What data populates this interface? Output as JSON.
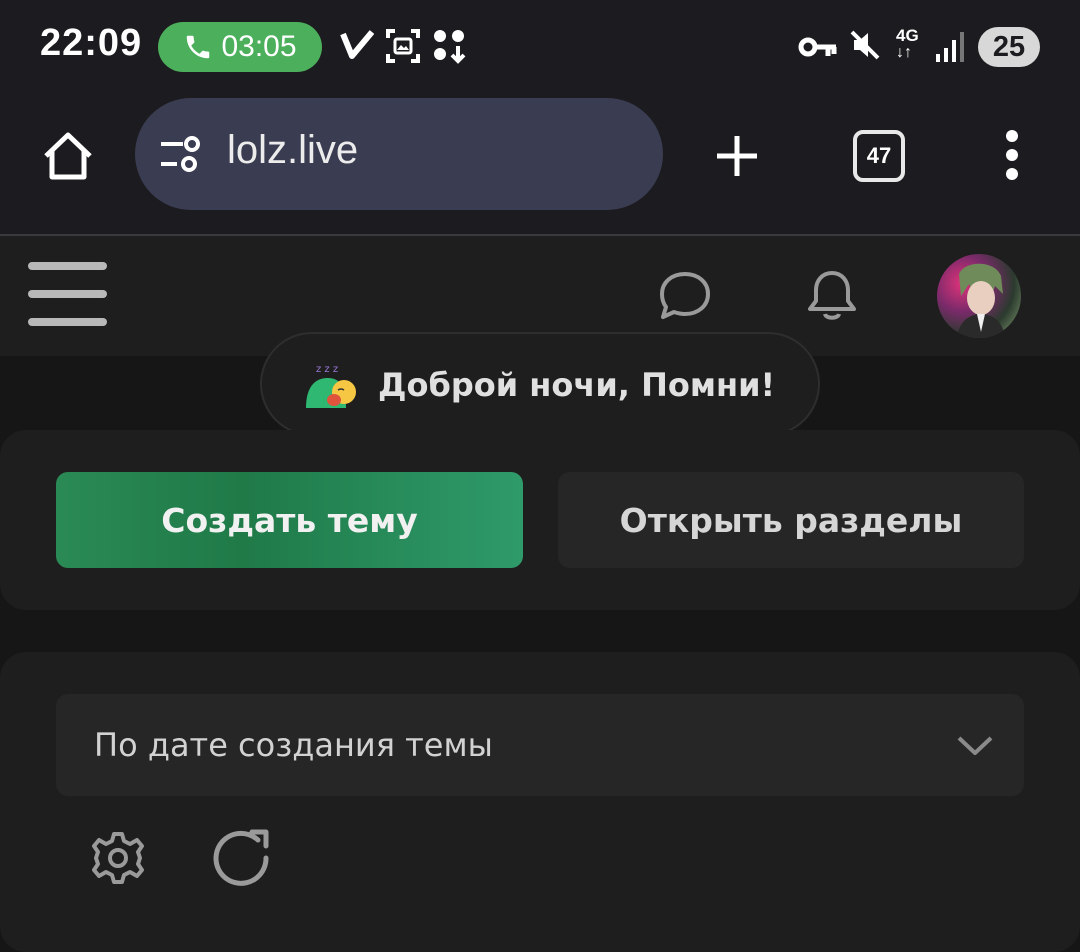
{
  "status_bar": {
    "time": "22:09",
    "call_duration": "03:05",
    "network": "4G",
    "battery": "25",
    "accent_color": "#4caf5b"
  },
  "browser": {
    "url": "lolz.live",
    "tab_count": "47",
    "icons": [
      "home-icon",
      "site-settings-icon",
      "new-tab-icon",
      "tab-switcher-icon",
      "more-menu-icon"
    ]
  },
  "site_header": {
    "icons": [
      "menu-icon",
      "chat-icon",
      "bell-icon",
      "avatar"
    ]
  },
  "greeting": {
    "emoji": "sleeping-sticker",
    "text": "Доброй ночи, Помни!"
  },
  "actions": {
    "create_label": "Создать тему",
    "open_label": "Открыть разделы",
    "create_color": "#228a52"
  },
  "sort": {
    "selected": "По дате создания темы",
    "icons": [
      "settings-icon",
      "refresh-icon"
    ]
  }
}
